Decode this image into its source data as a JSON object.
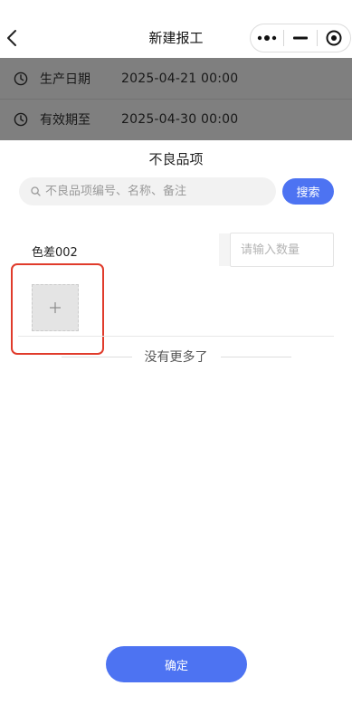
{
  "navbar": {
    "title": "新建报工",
    "back_icon": "chevron-left-icon",
    "menu_icons": [
      "more-dots-icon",
      "minimize-icon",
      "close-target-icon"
    ]
  },
  "form": {
    "rows": [
      {
        "icon": "clock-icon",
        "label": "生产日期",
        "value": "2025-04-21 00:00"
      },
      {
        "icon": "clock-icon",
        "label": "有效期至",
        "value": "2025-04-30 00:00"
      }
    ]
  },
  "sheet": {
    "title": "不良品项",
    "search": {
      "placeholder": "不良品项编号、名称、备注",
      "value": "",
      "button_label": "搜索"
    },
    "items": [
      {
        "name": "色差002",
        "quantity_placeholder": "请输入数量",
        "quantity": "",
        "upload_icon": "plus-icon"
      }
    ],
    "end_text": "没有更多了",
    "confirm_label": "确定"
  },
  "colors": {
    "accent": "#4d73f2",
    "highlight": "#e03b2b",
    "overlay": "rgba(0,0,0,0.5)"
  }
}
